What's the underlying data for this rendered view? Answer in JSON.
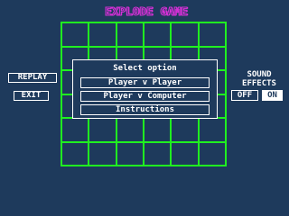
{
  "title": "EXPLODE GAME",
  "board": {
    "columns": 6,
    "rows": 6
  },
  "buttons": {
    "replay": "REPLAY",
    "exit": "EXIT"
  },
  "sound": {
    "label_line1": "SOUND",
    "label_line2": "EFFECTS",
    "off": "OFF",
    "on": "ON",
    "selected": "ON"
  },
  "dialog": {
    "title": "Select option",
    "options": [
      "Player v Player",
      "Player v Computer",
      "Instructions"
    ]
  },
  "colors": {
    "background": "#1e3a5c",
    "grid": "#20f020",
    "title": "#d830d8",
    "text": "#ffffff"
  }
}
